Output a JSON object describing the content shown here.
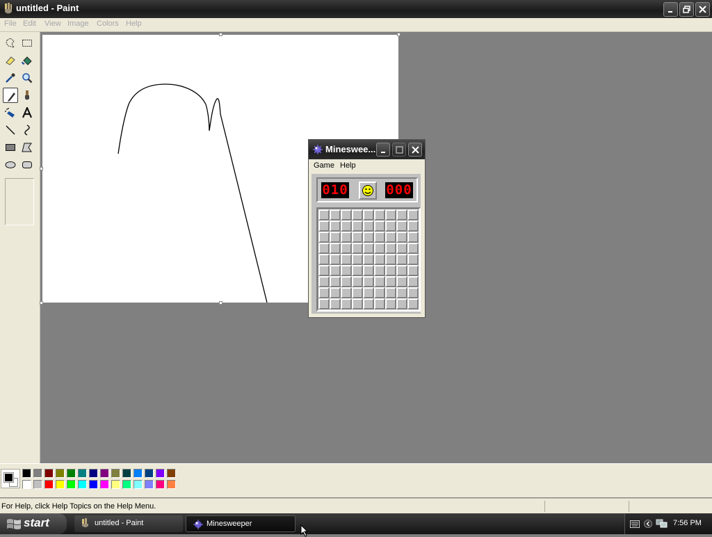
{
  "paint": {
    "title": "untitled - Paint",
    "menu": [
      "File",
      "Edit",
      "View",
      "Image",
      "Colors",
      "Help"
    ],
    "status_text": "For Help, click Help Topics on the Help Menu.",
    "tools": [
      "free-form-select-icon",
      "select-icon",
      "eraser-icon",
      "fill-icon",
      "color-picker-icon",
      "magnifier-icon",
      "pencil-icon",
      "brush-icon",
      "airbrush-icon",
      "text-icon",
      "line-icon",
      "curve-icon",
      "rectangle-icon",
      "polygon-icon",
      "ellipse-icon",
      "rounded-rectangle-icon"
    ],
    "selected_tool": "pencil-icon",
    "foreground_color": "#000000",
    "background_color": "#FFFFFF",
    "palette_top": [
      "#000000",
      "#808080",
      "#800000",
      "#808000",
      "#008000",
      "#008080",
      "#000080",
      "#800080",
      "#808040",
      "#004040",
      "#0080FF",
      "#004080",
      "#8000FF",
      "#804000"
    ],
    "palette_bottom": [
      "#FFFFFF",
      "#C0C0C0",
      "#FF0000",
      "#FFFF00",
      "#00FF00",
      "#00FFFF",
      "#0000FF",
      "#FF00FF",
      "#FFFF80",
      "#00FF80",
      "#80FFFF",
      "#8080FF",
      "#FF0080",
      "#FF8040"
    ]
  },
  "minesweeper": {
    "title": "Minesweе...",
    "menu": [
      "Game",
      "Help"
    ],
    "mines_left": "010",
    "timer": "000",
    "face": "smiley-icon",
    "rows": 9,
    "cols": 9
  },
  "taskbar": {
    "start_label": "start",
    "tasks": [
      {
        "label": "untitled - Paint",
        "icon": "paint-icon",
        "active": false
      },
      {
        "label": "Minesweeper",
        "icon": "minesweeper-icon",
        "active": true
      }
    ],
    "clock": "7:56 PM"
  }
}
